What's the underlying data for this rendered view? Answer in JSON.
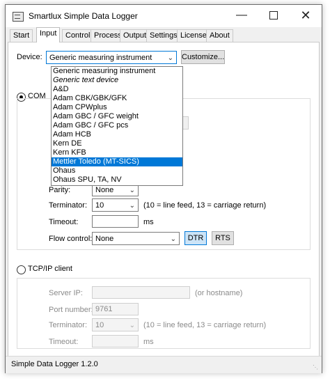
{
  "window": {
    "title": "Smartlux Simple Data Logger"
  },
  "tabs": [
    "Start",
    "Input",
    "Control",
    "Process",
    "Output",
    "Settings",
    "License",
    "About"
  ],
  "device": {
    "label": "Device:",
    "selected": "Generic measuring instrument",
    "customize_label": "Customize...",
    "options": [
      "Generic measuring instrument",
      "Generic text device",
      "A&D",
      "Adam CBK/GBK/GFK",
      "Adam CPWplus",
      "Adam GBC / GFC weight",
      "Adam GBC / GFC pcs",
      "Adam HCB",
      "Kern DE",
      "Kern KFB",
      "Mettler Toledo (MT-SICS)",
      "Ohaus",
      "Ohaus SPU, TA, NV"
    ],
    "highlighted": "Mettler Toledo (MT-SICS)"
  },
  "com": {
    "radio_label": "COM",
    "parity_label": "Parity:",
    "parity_value": "None",
    "terminator_label": "Terminator:",
    "terminator_value": "10",
    "terminator_hint": "(10 = line feed, 13 = carriage return)",
    "timeout_label": "Timeout:",
    "timeout_unit": "ms",
    "flow_label": "Flow control:",
    "flow_value": "None",
    "dtr_label": "DTR",
    "rts_label": "RTS"
  },
  "tcp": {
    "radio_label": "TCP/IP client",
    "server_label": "Server IP:",
    "server_hint": "(or hostname)",
    "port_label": "Port number:",
    "port_value": "9761",
    "terminator_label": "Terminator:",
    "terminator_value": "10",
    "terminator_hint": "(10 = line feed, 13 = carriage return)",
    "timeout_label": "Timeout:",
    "timeout_unit": "ms"
  },
  "status": {
    "text": "Simple Data Logger 1.2.0"
  }
}
